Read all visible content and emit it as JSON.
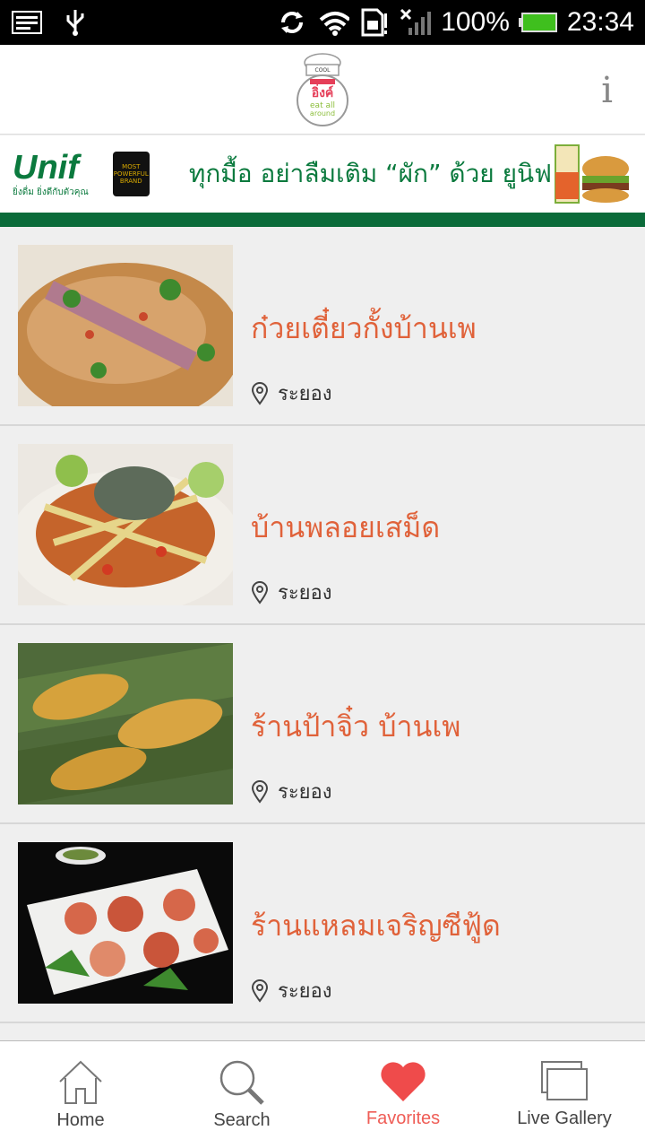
{
  "status_bar": {
    "battery": "100%",
    "time": "23:34",
    "icons": [
      "screenshot-icon",
      "usb-icon",
      "sync-icon",
      "wifi-icon",
      "sim-icon",
      "signal-icon",
      "battery-icon"
    ]
  },
  "header": {
    "logo_lines": [
      "COOL",
      "อิ่งค์",
      "eat all",
      "around"
    ],
    "info_label": "i"
  },
  "ad": {
    "brand": "Unif",
    "tagline": "ยิ่งดื่ม ยิ่งดีกับตัวคุณ",
    "award": "MOST POWERFUL BRAND",
    "slogan": "ทุกมื้อ อย่าลืมเติม “ผัก” ด้วย ยูนิฟ"
  },
  "items": [
    {
      "title": "ก๋วยเตี๋ยวกั้งบ้านเพ",
      "location": "ระยอง"
    },
    {
      "title": "บ้านพลอยเสม็ด",
      "location": "ระยอง"
    },
    {
      "title": "ร้านป้าจิ๋ว บ้านเพ",
      "location": "ระยอง"
    },
    {
      "title": "ร้านแหลมเจริญซีฟู้ด",
      "location": "ระยอง"
    }
  ],
  "nav": [
    {
      "label": "Home",
      "icon": "home-icon"
    },
    {
      "label": "Search",
      "icon": "search-icon"
    },
    {
      "label": "Favorites",
      "icon": "heart-icon",
      "active": true
    },
    {
      "label": "Live Gallery",
      "icon": "gallery-icon"
    }
  ],
  "colors": {
    "accent": "#e0623a",
    "favorites_active": "#ef5d56",
    "ad_green": "#0b6b3a"
  }
}
